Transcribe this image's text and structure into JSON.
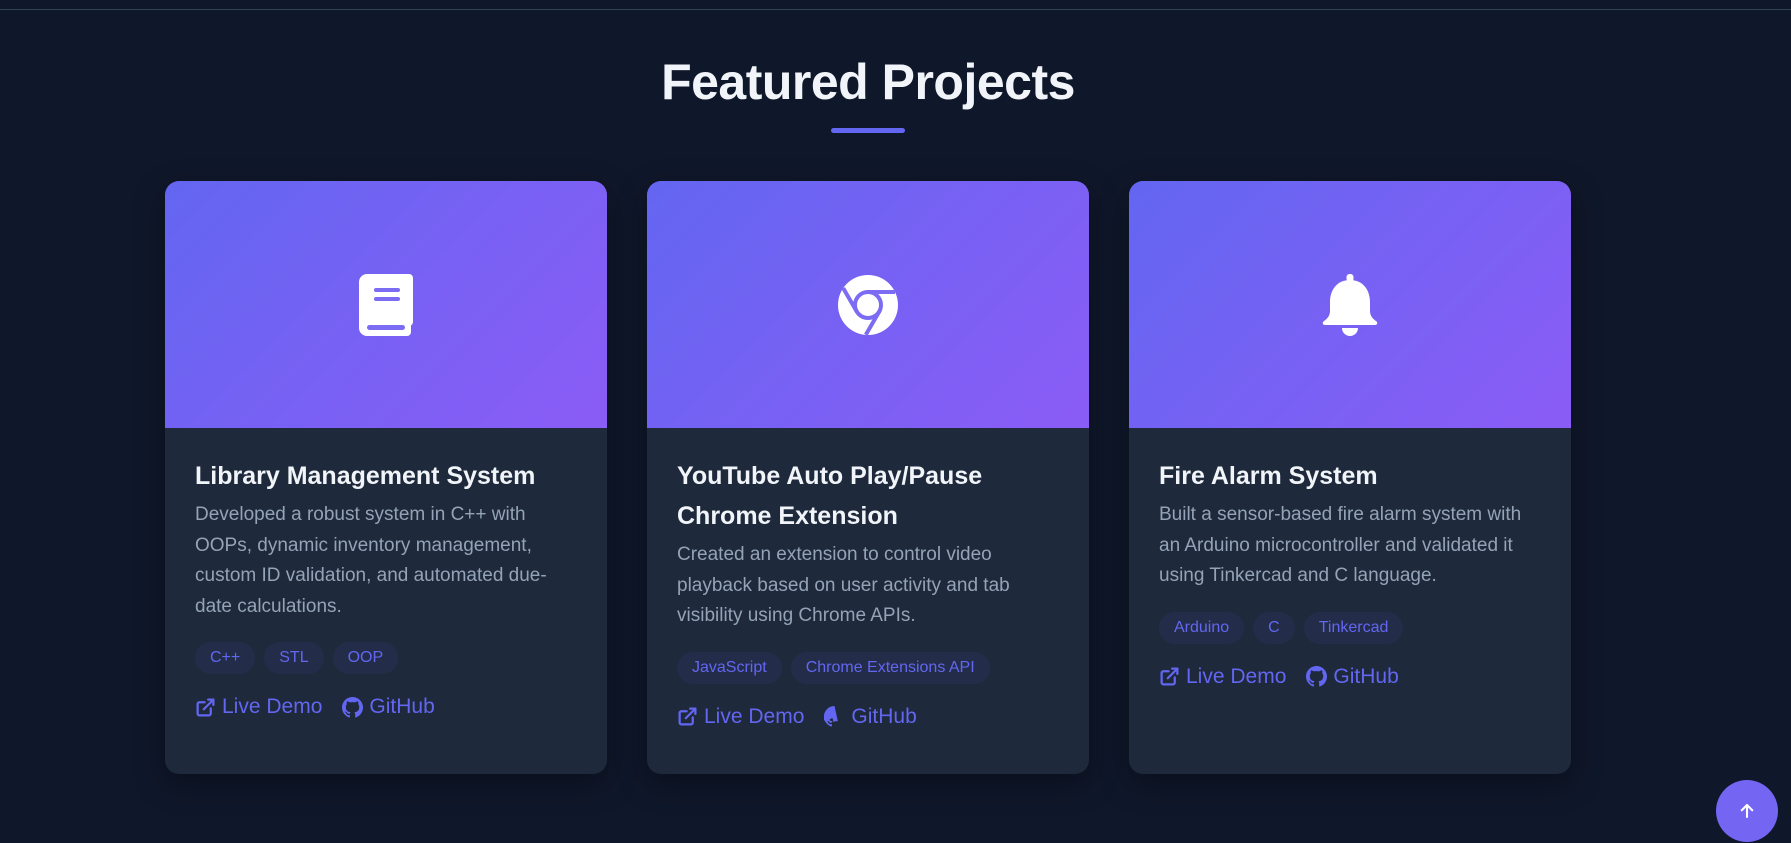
{
  "section": {
    "title": "Featured Projects"
  },
  "colors": {
    "background": "#0f172a",
    "card": "#1e293b",
    "accent": "#6366f1",
    "gradient_start": "#6366f1",
    "gradient_end": "#8b5cf6",
    "title_text": "#f1f5f9",
    "body_text": "#94a3b8"
  },
  "projects": [
    {
      "icon": "book-icon",
      "title": "Library Management System",
      "description": "Developed a robust system in C++ with OOPs, dynamic inventory management, custom ID validation, and automated due-date calculations.",
      "tags": [
        "C++",
        "STL",
        "OOP"
      ],
      "live_demo_label": "Live Demo",
      "github_label": "GitHub"
    },
    {
      "icon": "chrome-icon",
      "title": "YouTube Auto Play/Pause Chrome Extension",
      "description": "Created an extension to control video playback based on user activity and tab visibility using Chrome APIs.",
      "tags": [
        "JavaScript",
        "Chrome Extensions API"
      ],
      "live_demo_label": "Live Demo",
      "github_label": "GitHub"
    },
    {
      "icon": "bell-icon",
      "title": "Fire Alarm System",
      "description": "Built a sensor-based fire alarm system with an Arduino microcontroller and validated it using Tinkercad and C language.",
      "tags": [
        "Arduino",
        "C",
        "Tinkercad"
      ],
      "live_demo_label": "Live Demo",
      "github_label": "GitHub"
    }
  ],
  "scroll_top": {
    "icon": "arrow-up-icon"
  }
}
